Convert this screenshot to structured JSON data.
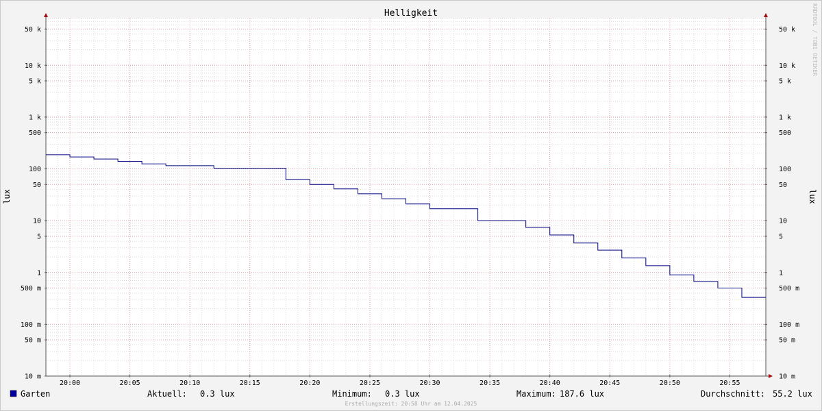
{
  "chart_data": {
    "type": "line",
    "title": "Helligkeit",
    "ylabel": "lux",
    "y_scale": "log",
    "ylim": [
      0.01,
      80000
    ],
    "x_start": "19:58",
    "x_end": "20:58",
    "x_ticks": [
      "20:00",
      "20:05",
      "20:10",
      "20:15",
      "20:20",
      "20:25",
      "20:30",
      "20:35",
      "20:40",
      "20:45",
      "20:50",
      "20:55"
    ],
    "y_ticks": [
      {
        "value": 50000,
        "label": "50 k"
      },
      {
        "value": 10000,
        "label": "10 k"
      },
      {
        "value": 5000,
        "label": "5 k"
      },
      {
        "value": 1000,
        "label": "1 k"
      },
      {
        "value": 500,
        "label": "500"
      },
      {
        "value": 100,
        "label": "100"
      },
      {
        "value": 50,
        "label": "50"
      },
      {
        "value": 10,
        "label": "10"
      },
      {
        "value": 5,
        "label": "5"
      },
      {
        "value": 1,
        "label": "1"
      },
      {
        "value": 0.5,
        "label": "500 m"
      },
      {
        "value": 0.1,
        "label": "100 m"
      },
      {
        "value": 0.05,
        "label": "50 m"
      },
      {
        "value": 0.01,
        "label": "10 m"
      }
    ],
    "series": [
      {
        "name": "Garten",
        "color": "#000080",
        "points": [
          {
            "x": "19:58",
            "y": 187.6
          },
          {
            "x": "20:00",
            "y": 170
          },
          {
            "x": "20:02",
            "y": 155
          },
          {
            "x": "20:04",
            "y": 140
          },
          {
            "x": "20:06",
            "y": 125
          },
          {
            "x": "20:08",
            "y": 115
          },
          {
            "x": "20:12",
            "y": 103
          },
          {
            "x": "20:18",
            "y": 62
          },
          {
            "x": "20:20",
            "y": 50
          },
          {
            "x": "20:22",
            "y": 41
          },
          {
            "x": "20:24",
            "y": 33
          },
          {
            "x": "20:26",
            "y": 26.5
          },
          {
            "x": "20:28",
            "y": 21
          },
          {
            "x": "20:30",
            "y": 17
          },
          {
            "x": "20:34",
            "y": 10
          },
          {
            "x": "20:38",
            "y": 7.4
          },
          {
            "x": "20:40",
            "y": 5.3
          },
          {
            "x": "20:42",
            "y": 3.7
          },
          {
            "x": "20:44",
            "y": 2.7
          },
          {
            "x": "20:46",
            "y": 1.9
          },
          {
            "x": "20:48",
            "y": 1.35
          },
          {
            "x": "20:50",
            "y": 0.9
          },
          {
            "x": "20:52",
            "y": 0.67
          },
          {
            "x": "20:54",
            "y": 0.5
          },
          {
            "x": "20:56",
            "y": 0.33
          },
          {
            "x": "20:58",
            "y": 0.33
          }
        ]
      }
    ],
    "grid": true,
    "legend_position": "bottom-left"
  },
  "legend": {
    "series_name": "Garten",
    "aktuell_label": "Aktuell:",
    "aktuell_value": "0.3 lux",
    "minimum_label": "Minimum:",
    "minimum_value": "0.3 lux",
    "maximum_label": "Maximum:",
    "maximum_value": "187.6 lux",
    "average_label": "Durchschnitt:",
    "average_value": "55.2 lux"
  },
  "footer": {
    "created": "Erstellungszeit: 20:58 Uhr am 12.04.2025"
  },
  "watermark": "RRDTOOL / TOBI OETIKER"
}
